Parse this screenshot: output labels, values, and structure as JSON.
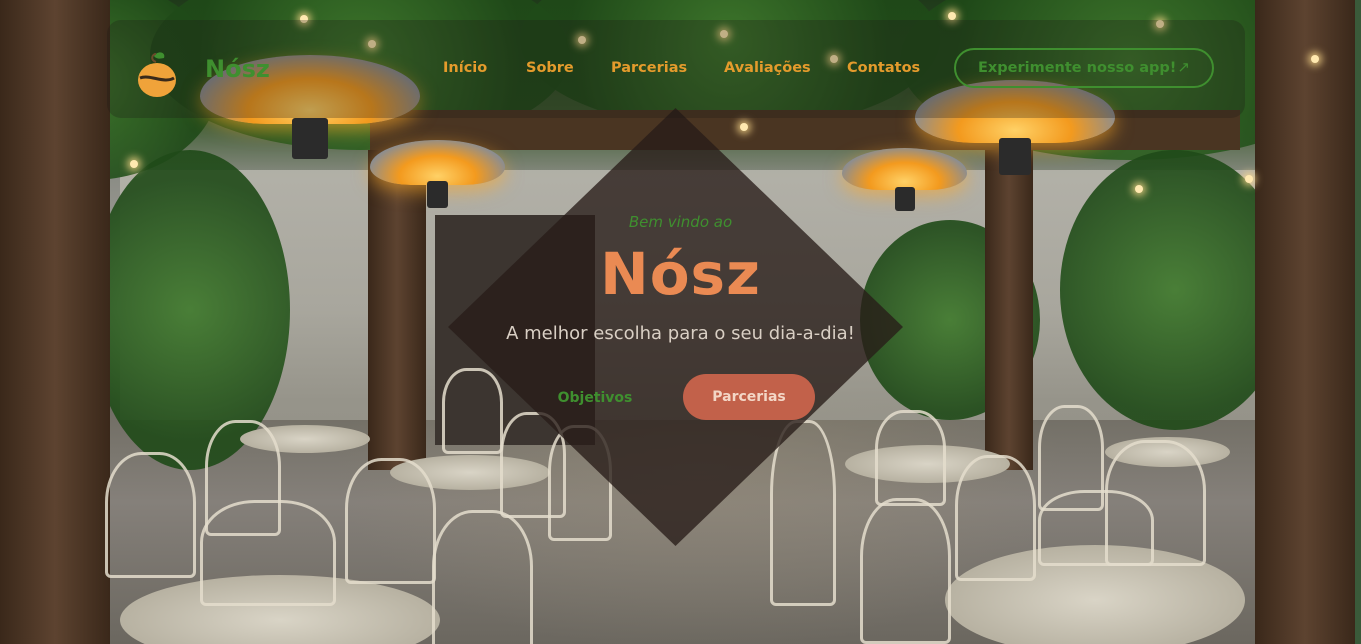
{
  "header": {
    "brand": "Nósz",
    "nav": [
      "Início",
      "Sobre",
      "Parcerias",
      "Avaliações",
      "Contatos"
    ],
    "cta_label": "Experimente nosso app!",
    "cta_icon": "↗"
  },
  "hero": {
    "welcome": "Bem vindo ao",
    "title": "Nósz",
    "subtitle": "A melhor escolha para o seu dia-a-dia!",
    "primary_button": "Parcerias",
    "secondary_button": "Objetivos"
  },
  "colors": {
    "green": "#3f8f2f",
    "orange_nav": "#e49b2c",
    "title_salmon": "#ea8a53",
    "button_bg": "#c2614a"
  },
  "icons": {
    "logo": "coffee-bean-logo-icon",
    "cta": "arrow-up-right-icon"
  }
}
